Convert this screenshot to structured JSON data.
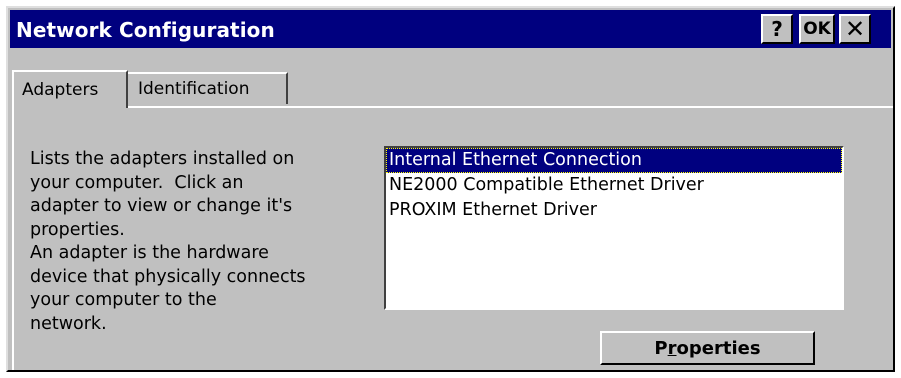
{
  "window": {
    "title": "Network Configuration",
    "help_label": "?",
    "ok_label": "OK",
    "close_label": "✕"
  },
  "tabs": [
    {
      "label": "Adapters",
      "active": true
    },
    {
      "label": "Identification",
      "active": false
    }
  ],
  "description": [
    "Lists the adapters installed on",
    "your computer.  Click an",
    "adapter to view or change it's",
    "properties.",
    "An adapter is the hardware",
    "device that physically connects",
    "your computer to the",
    "network."
  ],
  "adapters": [
    {
      "label": "Internal Ethernet Connection",
      "selected": true
    },
    {
      "label": "NE2000 Compatible Ethernet Driver",
      "selected": false
    },
    {
      "label": "PROXIM Ethernet Driver",
      "selected": false
    }
  ],
  "properties_button": {
    "label_before": "P",
    "label_mnemonic": "r",
    "label_after": "operties"
  },
  "colors": {
    "titlebar": "#00007f",
    "face": "#c0c0c0",
    "selection": "#00007f"
  }
}
